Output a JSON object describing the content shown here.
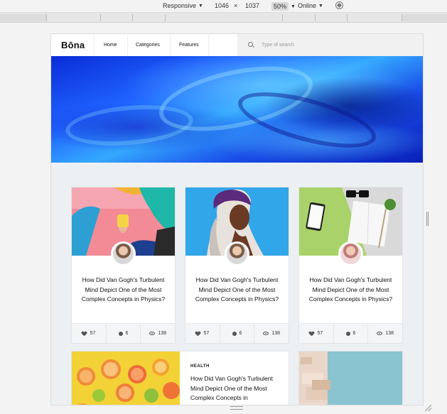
{
  "devtools": {
    "device": "Responsive",
    "width": "1046",
    "times": "×",
    "height": "1037",
    "zoom": "50%",
    "network": "Online",
    "rotate_icon": "rotate-icon"
  },
  "site": {
    "logo": "Bōna",
    "nav": [
      "Home",
      "Categories",
      "Features"
    ],
    "search_placeholder": "Type of search"
  },
  "cards": [
    {
      "title": "How Did Van Gogh's Turbulent Mind Depict One of the Most Complex Concepts in Physics?",
      "likes": "57",
      "comments": "6",
      "views": "138"
    },
    {
      "title": "How Did Van Gogh's Turbulent Mind Depict One of the Most Complex Concepts in Physics?",
      "likes": "57",
      "comments": "6",
      "views": "138"
    },
    {
      "title": "How Did Van Gogh's Turbulent Mind Depict One of the Most Complex Concepts in Physics?",
      "likes": "57",
      "comments": "6",
      "views": "138"
    }
  ],
  "featured_card": {
    "category": "HEALTH",
    "title": "How Did Van Gogh's Turbulent Mind Depict One of the Most Complex Concepts in"
  },
  "colors": {
    "hero_blue": "#1f63ff",
    "card_bg": "#ffffff",
    "page_bg": "#edf0f2"
  }
}
